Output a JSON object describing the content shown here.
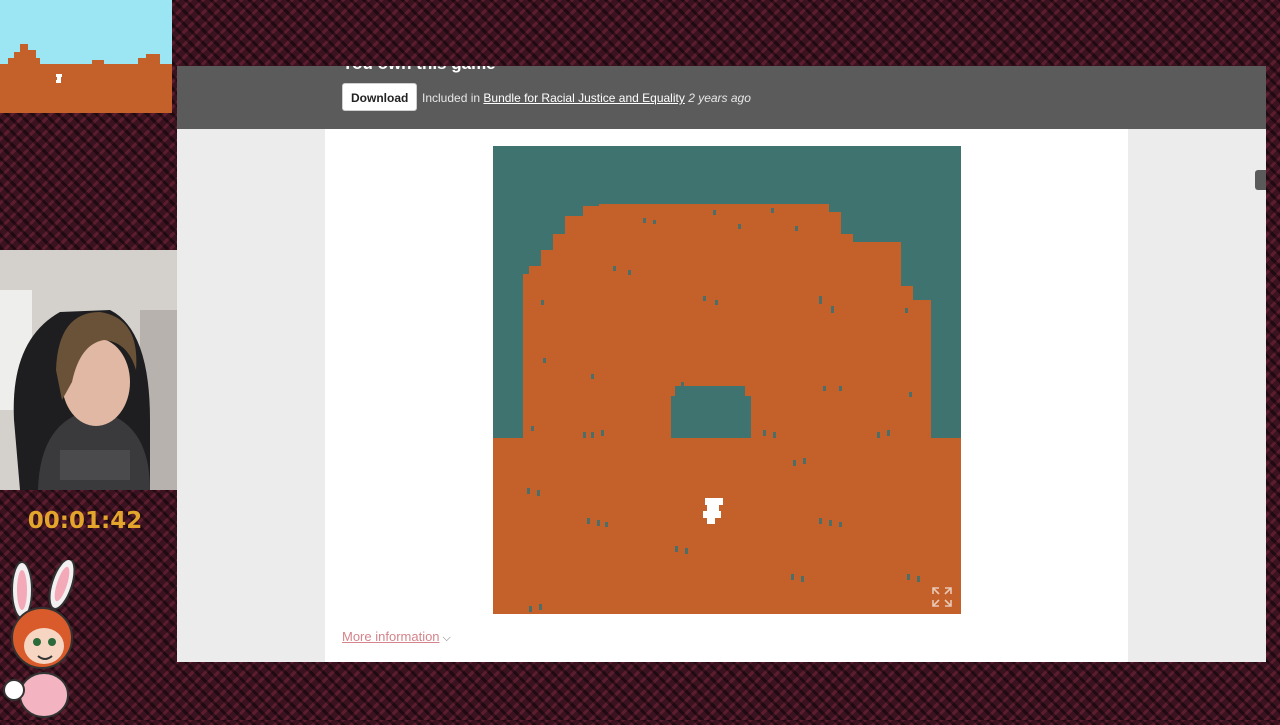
{
  "purchase": {
    "owned_text": "You own this game",
    "download_label": "Download",
    "included_prefix": "Included in ",
    "bundle_name": "Bundle for Racial Justice and Equality",
    "included_time": "2 years ago"
  },
  "main": {
    "more_info_label": "More information",
    "more_info_chevron": "⌵"
  },
  "stream": {
    "timer": "00:01:42"
  },
  "colors": {
    "sky": "#3e7370",
    "rock": "#c4602a",
    "player": "#ffffff",
    "thumb_sky": "#9be6f2",
    "timer": "#e3a52b",
    "purchase_bar": "#5b5b5b"
  },
  "icons": {
    "fullscreen": "fullscreen-icon",
    "more_info": "chevron-down-icon"
  }
}
